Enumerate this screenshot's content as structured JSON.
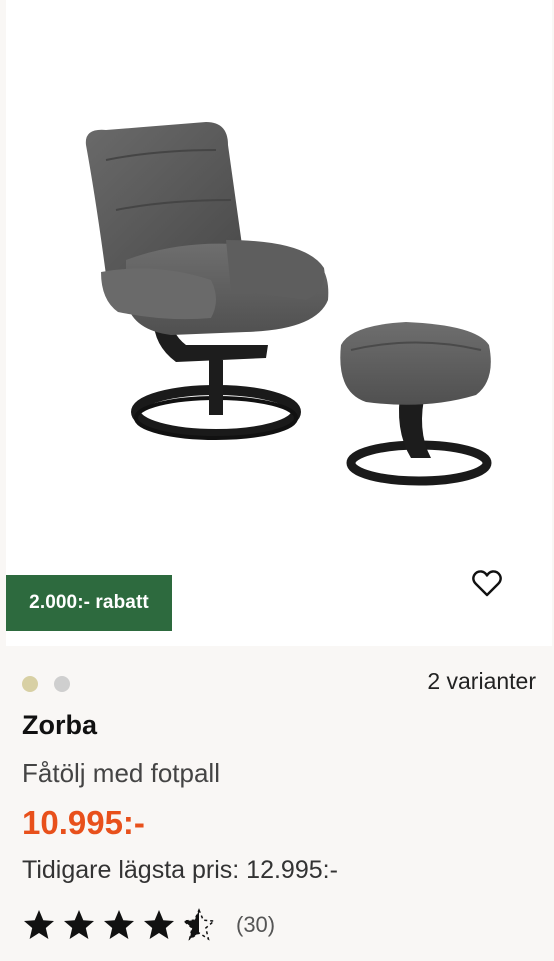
{
  "product": {
    "badge": "2.000:- rabatt",
    "name": "Zorba",
    "subtitle": "Fåtölj med fotpall",
    "price": "10.995:-",
    "previous_price": "Tidigare lägsta pris: 12.995:-",
    "variants_label": "2 varianter",
    "rating": 4.5,
    "review_count": "(30)",
    "image_icon": "armchair-with-footstool-photo"
  },
  "swatches": [
    {
      "name": "beige",
      "color": "#d8d0a4"
    },
    {
      "name": "grey",
      "color": "#cfcfcf"
    }
  ],
  "colors": {
    "badge_bg": "#2d6a3e",
    "price": "#e8501b",
    "image_bg": "#ffffff",
    "card_bg": "#f9f7f5"
  }
}
